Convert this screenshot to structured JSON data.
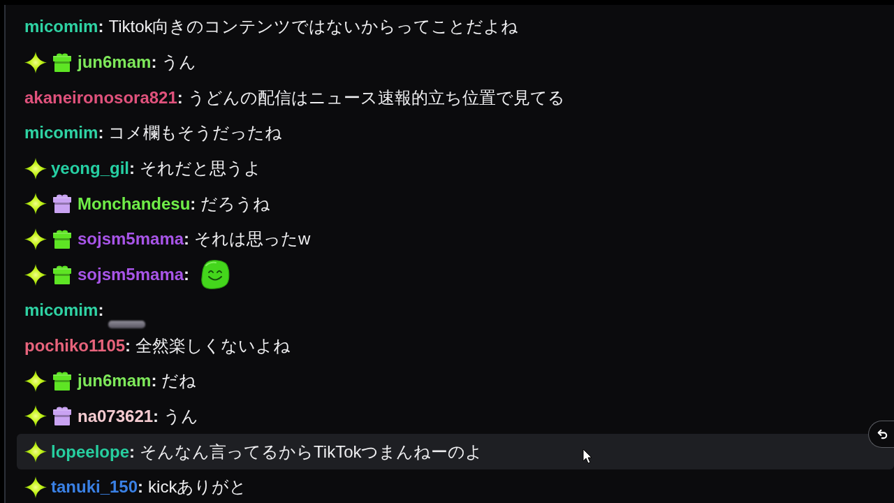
{
  "messages": [
    {
      "username": "micomim",
      "color": "#2fd3a4",
      "separator": ":",
      "content": {
        "kind": "text",
        "text": "Tiktok向きのコンテンツではないからってことだよね"
      },
      "highlighted": false
    },
    {
      "badges": [
        {
          "kind": "sparkle"
        },
        {
          "kind": "gift",
          "color": "#5ee524"
        }
      ],
      "username": "jun6mam",
      "color": "#7ee85a",
      "separator": ":",
      "content": {
        "kind": "text",
        "text": "うん"
      },
      "highlighted": false
    },
    {
      "username": "akaneironosora821",
      "color": "#e0527c",
      "separator": ":",
      "content": {
        "kind": "text",
        "text": "うどんの配信はニュース速報的立ち位置で見てる"
      },
      "highlighted": false
    },
    {
      "username": "micomim",
      "color": "#2fd3a4",
      "separator": ":",
      "content": {
        "kind": "text",
        "text": "コメ欄もそうだったね"
      },
      "highlighted": false
    },
    {
      "badges": [
        {
          "kind": "sparkle"
        }
      ],
      "username": "yeong_gil",
      "color": "#26cfa3",
      "separator": ":",
      "content": {
        "kind": "text",
        "text": "それだと思うよ"
      },
      "highlighted": false
    },
    {
      "badges": [
        {
          "kind": "sparkle"
        },
        {
          "kind": "gift",
          "color": "#c9a3f2"
        }
      ],
      "username": "Monchandesu",
      "color": "#70ee48",
      "separator": ":",
      "content": {
        "kind": "text",
        "text": "だろうね"
      },
      "highlighted": false
    },
    {
      "badges": [
        {
          "kind": "sparkle"
        },
        {
          "kind": "gift",
          "color": "#5ee524"
        }
      ],
      "username": "sojsm5mama",
      "color": "#a855e8",
      "separator": ":",
      "content": {
        "kind": "text",
        "text": "それは思ったw"
      },
      "highlighted": false
    },
    {
      "badges": [
        {
          "kind": "sparkle"
        },
        {
          "kind": "gift",
          "color": "#5ee524"
        }
      ],
      "username": "sojsm5mama",
      "color": "#a855e8",
      "separator": ":",
      "content": {
        "kind": "emote"
      },
      "highlighted": false
    },
    {
      "username": "micomim",
      "color": "#2fd3a4",
      "separator": ":",
      "content": {
        "kind": "blurred"
      },
      "highlighted": false
    },
    {
      "username": "pochiko1105",
      "color": "#e8647c",
      "separator": ":",
      "content": {
        "kind": "text",
        "text": "全然楽しくないよね"
      },
      "highlighted": false
    },
    {
      "badges": [
        {
          "kind": "sparkle"
        },
        {
          "kind": "gift",
          "color": "#5ee524"
        }
      ],
      "username": "jun6mam",
      "color": "#7ee85a",
      "separator": ":",
      "content": {
        "kind": "text",
        "text": "だね"
      },
      "highlighted": false
    },
    {
      "badges": [
        {
          "kind": "sparkle"
        },
        {
          "kind": "gift",
          "color": "#c9a3f2"
        }
      ],
      "username": "na073621",
      "color": "#f4cbd0",
      "separator": ":",
      "content": {
        "kind": "text",
        "text": "うん"
      },
      "highlighted": false
    },
    {
      "badges": [
        {
          "kind": "sparkle"
        }
      ],
      "username": "lopeelope",
      "color": "#27cfa0",
      "separator": ":",
      "content": {
        "kind": "text",
        "text": "そんなん言ってるからTikTokつまんねーのよ"
      },
      "highlighted": true
    },
    {
      "badges": [
        {
          "kind": "sparkle"
        }
      ],
      "username": "tanuki_150",
      "color": "#3a80e4",
      "separator": ":",
      "content": {
        "kind": "text",
        "text": "kickありがと"
      },
      "highlighted": false
    }
  ]
}
